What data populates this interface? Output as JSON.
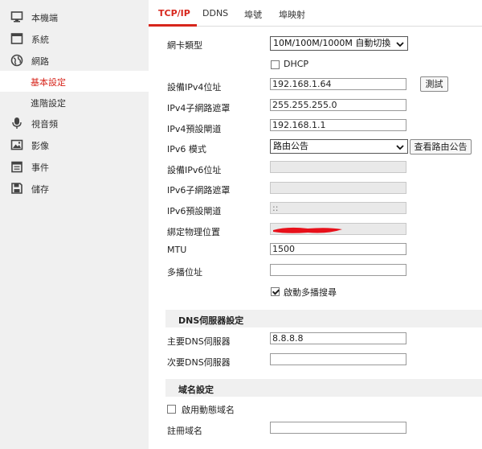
{
  "sidebar": {
    "items": [
      {
        "label": "本機端",
        "icon": "monitor-icon"
      },
      {
        "label": "系統",
        "icon": "window-icon"
      },
      {
        "label": "網路",
        "icon": "globe-icon"
      },
      {
        "label": "基本設定",
        "active": true
      },
      {
        "label": "進階設定"
      },
      {
        "label": "視音頻",
        "icon": "microphone-icon"
      },
      {
        "label": "影像",
        "icon": "image-icon"
      },
      {
        "label": "事件",
        "icon": "calendar-icon"
      },
      {
        "label": "儲存",
        "icon": "save-icon"
      }
    ]
  },
  "tabs": [
    "TCP/IP",
    "DDNS",
    "埠號",
    "埠映射"
  ],
  "form": {
    "nic_type_label": "網卡類型",
    "nic_type_value": "10M/100M/1000M 自動切換",
    "dhcp_label": "DHCP",
    "dhcp_checked": false,
    "ipv4_label": "設備IPv4位址",
    "ipv4_value": "192.168.1.64",
    "test_button": "測試",
    "ipv4_mask_label": "IPv4子網路遮罩",
    "ipv4_mask_value": "255.255.255.0",
    "ipv4_gw_label": "IPv4預設閘道",
    "ipv4_gw_value": "192.168.1.1",
    "ipv6_mode_label": "IPv6 模式",
    "ipv6_mode_value": "路由公告",
    "view_route_button": "查看路由公告",
    "ipv6_addr_label": "設備IPv6位址",
    "ipv6_addr_value": "",
    "ipv6_mask_label": "IPv6子網路遮罩",
    "ipv6_mask_value": "",
    "ipv6_gw_label": "IPv6預設閘道",
    "ipv6_gw_value": "::",
    "mac_label": "綁定物理位置",
    "mac_value": "",
    "mtu_label": "MTU",
    "mtu_value": "1500",
    "multicast_label": "多播位址",
    "multicast_value": "",
    "multicast_discovery_label": "啟動多播搜尋",
    "multicast_discovery_checked": true
  },
  "dns": {
    "section_title": "DNS伺服器設定",
    "primary_label": "主要DNS伺服器",
    "primary_value": "8.8.8.8",
    "secondary_label": "次要DNS伺服器",
    "secondary_value": ""
  },
  "domain": {
    "section_title": "域名設定",
    "ddns_enable_label": "啟用動態域名",
    "ddns_enable_checked": false,
    "register_label": "註冊域名",
    "register_value": ""
  },
  "colors": {
    "accent": "#d7261c",
    "redaction": "#e8101a"
  }
}
